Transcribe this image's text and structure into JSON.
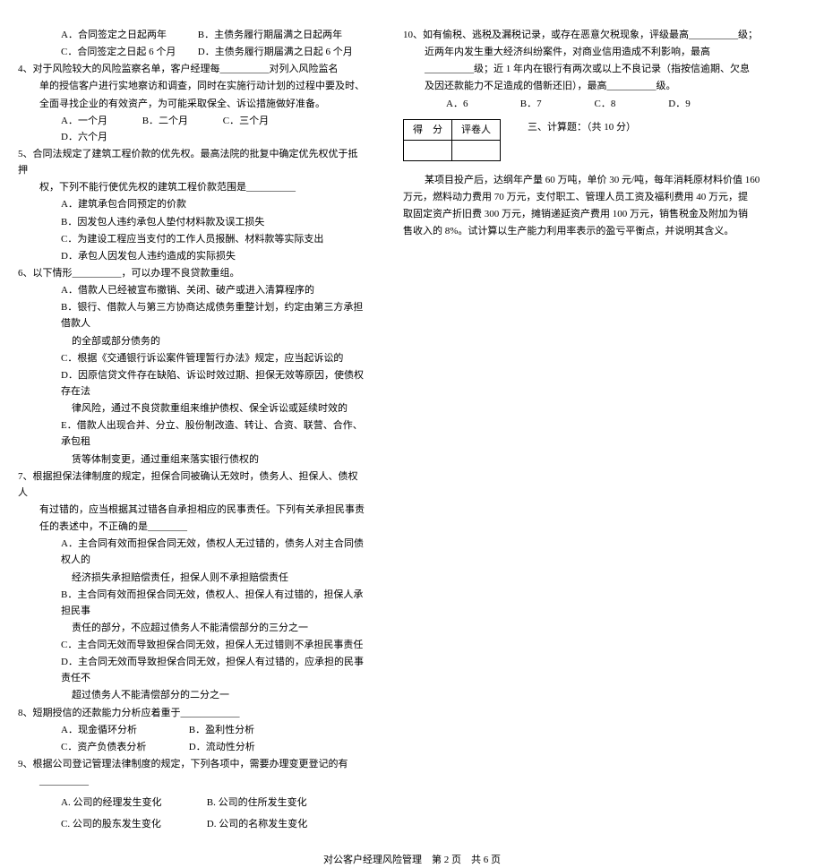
{
  "q3": {
    "optA": "A．合同签定之日起两年",
    "optB": "B．主债务履行期届满之日起两年",
    "optC": "C．合同签定之日起 6 个月",
    "optD": "D．主债务履行期届满之日起 6 个月"
  },
  "q4": {
    "stem1": "4、对于风险较大的风险监察名单，客户经理每__________对列入风险监名",
    "stem2": "单的授信客户进行实地察访和调查，同时在实施行动计划的过程中要及时、",
    "stem3": "全面寻找企业的有效资产，为可能采取保全、诉讼措施做好准备。",
    "optA": "A．一个月",
    "optB": "B．二个月",
    "optC": "C．三个月",
    "optD": "D．六个月"
  },
  "q5": {
    "stem1": "5、合同法规定了建筑工程价款的优先权。最高法院的批复中确定优先权优于抵押",
    "stem2": "权，下列不能行使优先权的建筑工程价款范围是__________",
    "optA": "A．建筑承包合同预定的价款",
    "optB": "B．因发包人违约承包人垫付材料款及误工损失",
    "optC": "C．为建设工程应当支付的工作人员报酬、材料款等实际支出",
    "optD": "D．承包人因发包人违约造成的实际损失"
  },
  "q6": {
    "stem": "6、以下情形__________，可以办理不良贷款重组。",
    "optA": "A．借款人已经被宣布撤销、关闭、破产或进入清算程序的",
    "optB1": "B．银行、借款人与第三方协商达成债务重整计划，约定由第三方承担借款人",
    "optB2": "的全部或部分债务的",
    "optC": "C．根据《交通银行诉讼案件管理暂行办法》规定，应当起诉讼的",
    "optD1": "D．因原信贷文件存在缺陷、诉讼时效过期、担保无效等原因，使债权存在法",
    "optD2": "律风险，通过不良贷款重组来维护债权、保全诉讼或延续时效的",
    "optE1": "E．借款人出现合并、分立、股份制改造、转让、合资、联营、合作、承包租",
    "optE2": "赁等体制变更，通过重组来落实银行债权的"
  },
  "q7": {
    "stem1": "7、根据担保法律制度的规定，担保合同被确认无效时，债务人、担保人、债权人",
    "stem2": "有过错的，应当根据其过错各自承担相应的民事责任。下列有关承担民事责",
    "stem3": "任的表述中，不正确的是________",
    "optA1": "A．主合同有效而担保合同无效，债权人无过错的，债务人对主合同债权人的",
    "optA2": "经济损失承担赔偿责任，担保人则不承担赔偿责任",
    "optB1": "B．主合同有效而担保合同无效，债权人、担保人有过错的，担保人承担民事",
    "optB2": "责任的部分，不应超过债务人不能清偿部分的三分之一",
    "optC": "C．主合同无效而导致担保合同无效，担保人无过错则不承担民事责任",
    "optD1": "D．主合同无效而导致担保合同无效，担保人有过错的，应承担的民事责任不",
    "optD2": "超过债务人不能清偿部分的二分之一"
  },
  "q8": {
    "stem": "8、短期授信的还款能力分析应着重于____________",
    "optA": "A．现金循环分析",
    "optB": "B．盈利性分析",
    "optC": "C．资产负债表分析",
    "optD": "D．流动性分析"
  },
  "q9": {
    "stem1": "9、根据公司登记管理法律制度的规定，下列各项中，需要办理变更登记的有",
    "stem2": "__________",
    "optA": "A. 公司的经理发生变化",
    "optB": "B. 公司的住所发生变化",
    "optC": "C. 公司的股东发生变化",
    "optD": "D. 公司的名称发生变化"
  },
  "q10": {
    "stem1": "10、如有偷税、逃税及漏税记录，或存在恶意欠税现象，评级最高__________级；",
    "stem2": "近两年内发生重大经济纠纷案件，对商业信用造成不利影响，最高",
    "stem3": "__________级；近 1 年内在银行有两次或以上不良记录（指按信逾期、欠息",
    "stem4": "及因还款能力不足造成的借新还旧），最高__________级。",
    "optA": "A．6",
    "optB": "B．7",
    "optC": "C．8",
    "optD": "D．9"
  },
  "scoreTable": {
    "h1": "得　分",
    "h2": "评卷人"
  },
  "section3": {
    "title": "三、计算题：（共 10 分）",
    "body1": "某项目投产后，达纲年产量 60 万吨，单价 30 元/吨，每年消耗原材料价值 160",
    "body2": "万元，燃料动力费用 70 万元，支付职工、管理人员工资及福利费用 40 万元，提",
    "body3": "取固定资产折旧费 300 万元，摊销递延资产费用 100 万元，销售税金及附加为销",
    "body4": "售收入的 8%。试计算以生产能力利用率表示的盈亏平衡点，并说明其含义。"
  },
  "footer": "对公客户经理风险管理　第 2 页　共 6 页"
}
